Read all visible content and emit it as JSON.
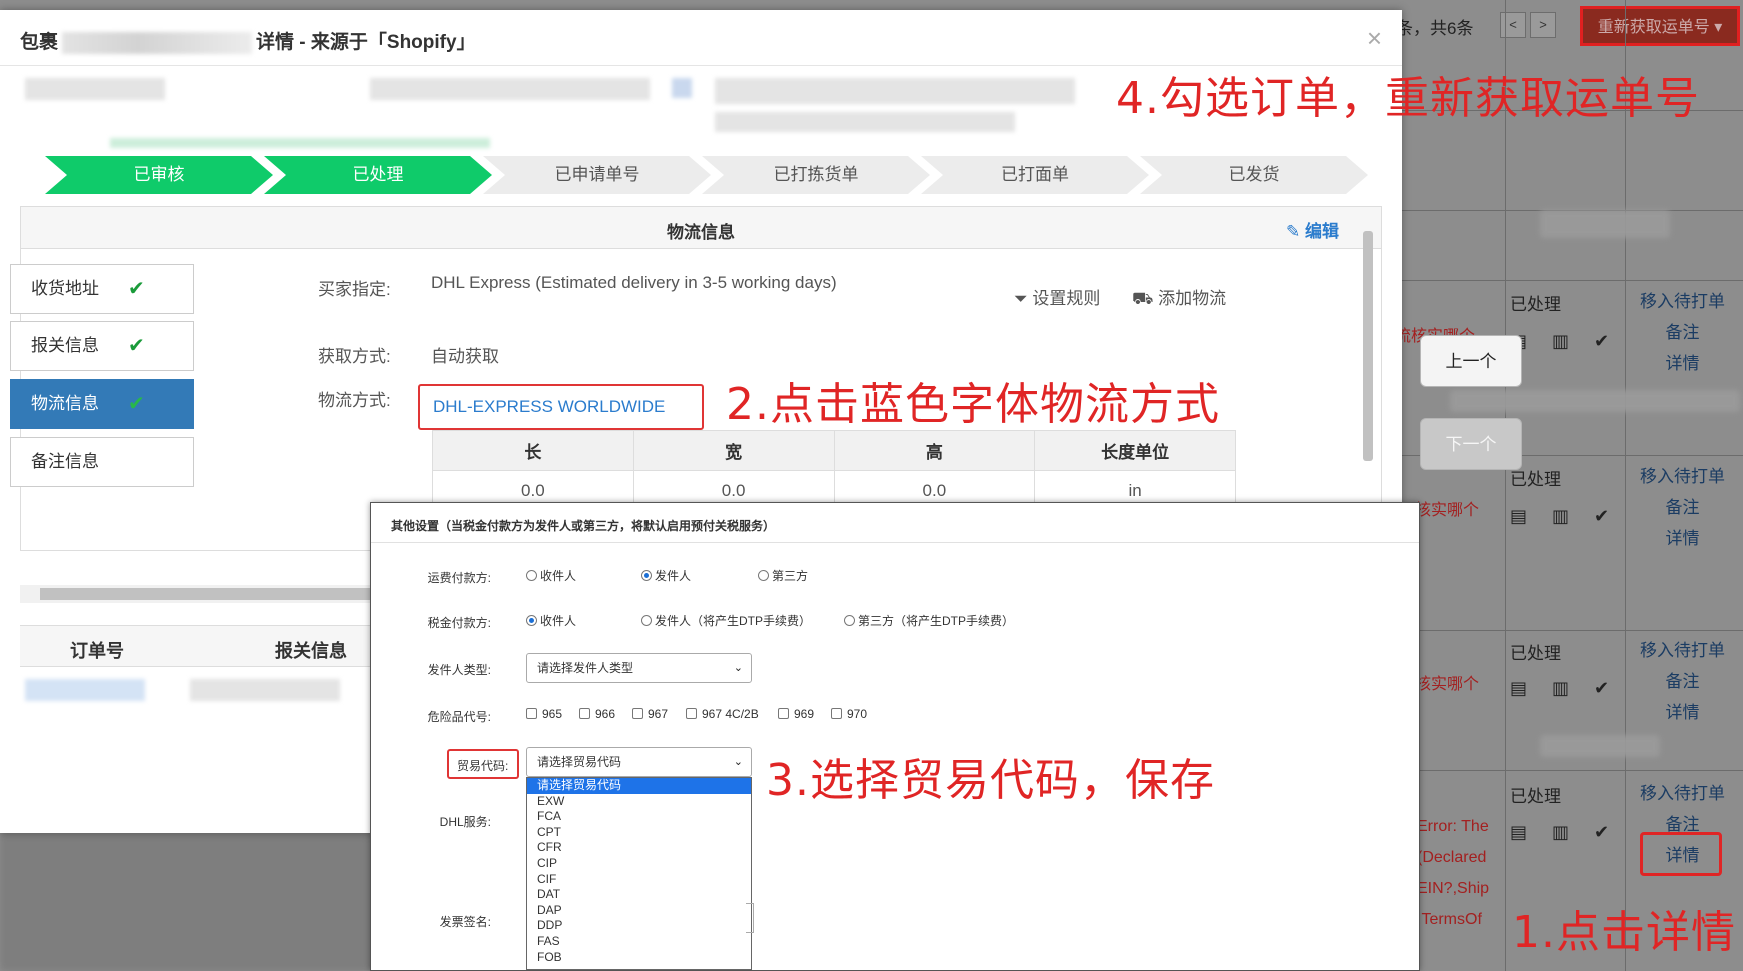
{
  "background": {
    "page_count": "条，共6条",
    "prev_page_icon": "<",
    "next_page_icon": ">",
    "refetch_button": "重新获取运单号 ▾",
    "rows": [
      {
        "status": "已处理",
        "error": "流核实哪个",
        "links": [
          "移入待打单",
          "备注",
          "详情"
        ]
      },
      {
        "status": "已处理",
        "error": "核实哪个",
        "links": [
          "移入待打单",
          "备注",
          "详情"
        ]
      },
      {
        "status": "已处理",
        "error": "核实哪个",
        "links": [
          "移入待打单",
          "备注",
          "详情"
        ]
      },
      {
        "status": "已处理",
        "error_lines": [
          "Error: The",
          "(Declared",
          "EIN?,Ship",
          ",TermsOf"
        ],
        "links": [
          "移入待打单",
          "备注",
          "详情"
        ]
      }
    ],
    "nav_prev": "上一个",
    "nav_next": "下一个"
  },
  "modal": {
    "title_prefix": "包裹",
    "title_suffix": "详情 - 来源于「Shopify」",
    "close_icon": "×",
    "steps": [
      {
        "label": "已审核",
        "state": "done"
      },
      {
        "label": "已处理",
        "state": "done"
      },
      {
        "label": "已申请单号",
        "state": "todo"
      },
      {
        "label": "已打拣货单",
        "state": "todo"
      },
      {
        "label": "已打面单",
        "state": "todo"
      },
      {
        "label": "已发货",
        "state": "todo"
      }
    ],
    "side_tabs": [
      {
        "label": "收货地址",
        "tick": "✔"
      },
      {
        "label": "报关信息",
        "tick": "✔"
      },
      {
        "label": "物流信息",
        "tick": "✔"
      },
      {
        "label": "备注信息"
      }
    ],
    "panel": {
      "title": "物流信息",
      "edit": "编辑",
      "buyer_label": "买家指定:",
      "buyer_value": "DHL Express (Estimated delivery in 3-5 working days)",
      "fetch_label": "获取方式:",
      "fetch_value": "自动获取",
      "method_label": "物流方式:",
      "method_value": "DHL-EXPRESS WORLDWIDE",
      "set_rule": "设置规则",
      "add_logistics": "添加物流",
      "dims_headers": [
        "长",
        "宽",
        "高",
        "长度单位"
      ],
      "dims_values": [
        "0.0",
        "0.0",
        "0.0",
        "in"
      ]
    },
    "orders_table": {
      "col_order": "订单号",
      "col_customs": "报关信息"
    }
  },
  "dialog": {
    "title": "其他设置（当税金付款方为发件人或第三方，将默认启用预付关税服务）",
    "freight_payer_label": "运费付款方:",
    "freight_payer_options": [
      {
        "label": "收件人",
        "checked": false
      },
      {
        "label": "发件人",
        "checked": true
      },
      {
        "label": "第三方",
        "checked": false
      }
    ],
    "tax_payer_label": "税金付款方:",
    "tax_payer_options": [
      {
        "label": "收件人",
        "checked": true
      },
      {
        "label": "发件人（将产生DTP手续费）",
        "checked": false
      },
      {
        "label": "第三方（将产生DTP手续费）",
        "checked": false
      }
    ],
    "sender_type_label": "发件人类型:",
    "sender_type_value": "请选择发件人类型",
    "dangerous_label": "危险品代号:",
    "dangerous_options": [
      "965",
      "966",
      "967",
      "967 4C/2B",
      "969",
      "970"
    ],
    "trade_code_label": "贸易代码:",
    "trade_code_value": "请选择贸易代码",
    "trade_code_options": [
      "请选择贸易代码",
      "EXW",
      "FCA",
      "CPT",
      "CFR",
      "CIP",
      "CIF",
      "DAT",
      "DAP",
      "DDP",
      "FAS",
      "FOB"
    ],
    "dhl_service_label": "DHL服务:",
    "invoice_sign_label": "发票签名:"
  },
  "annotations": {
    "step1": "1.点击详情",
    "step2": "2.点击蓝色字体物流方式",
    "step3": "3.选择贸易代码，保存",
    "step4": "4.勾选订单，重新获取运单号"
  },
  "colors": {
    "step_done": "#0fcb6a",
    "link_blue": "#2b7ccd",
    "annotation_red": "#e02525",
    "active_tab": "#337ab7"
  }
}
